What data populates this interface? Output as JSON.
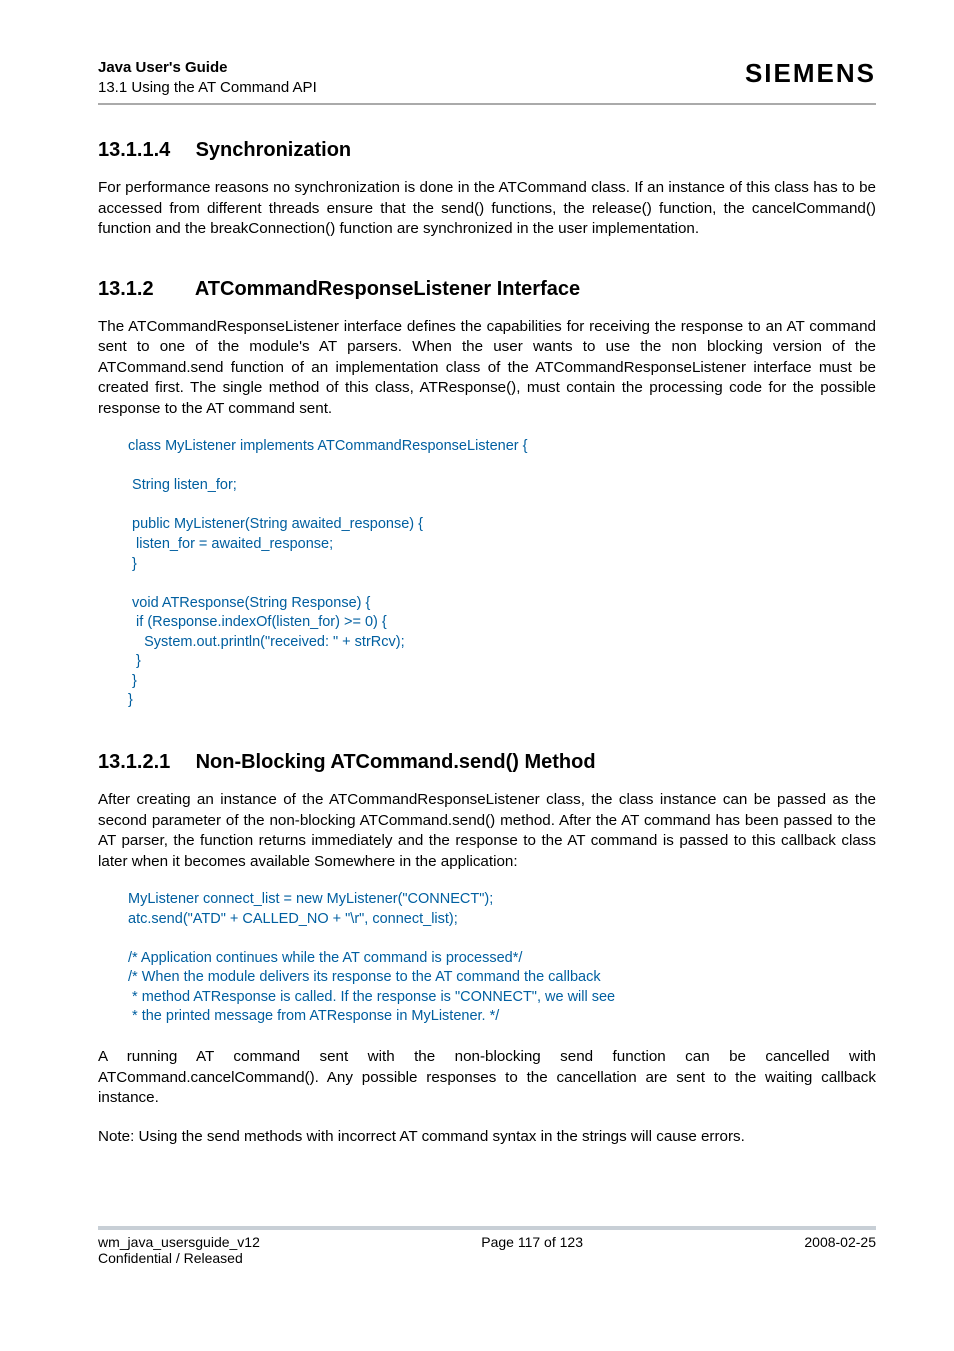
{
  "header": {
    "title": "Java User's Guide",
    "subtitle": "13.1 Using the AT Command API",
    "brand": "SIEMENS"
  },
  "sections": {
    "s1": {
      "num": "13.1.1.4",
      "title": "Synchronization",
      "para": "For performance reasons no synchronization is done in the ATCommand class. If an instance of this class has to be accessed from different threads ensure that the send() functions, the release() function, the cancelCommand() function and the breakConnection() function are synchronized in the user implementation."
    },
    "s2": {
      "num": "13.1.2",
      "title": "ATCommandResponseListener Interface",
      "para": "The ATCommandResponseListener interface defines the capabilities for receiving the response to an AT command sent to one of the module's AT parsers. When the user wants to use the non blocking version of the ATCommand.send function of an implementation class of the ATCommandResponseListener interface must be created first. The single method of this class, ATResponse(), must contain the processing code for the possible response to the AT command sent.",
      "code": "class MyListener implements ATCommandResponseListener {\n\n String listen_for;\n\n public MyListener(String awaited_response) {\n  listen_for = awaited_response;\n }\n\n void ATResponse(String Response) {\n  if (Response.indexOf(listen_for) >= 0) {\n    System.out.println(\"received: \" + strRcv);\n  }\n }\n}"
    },
    "s3": {
      "num": "13.1.2.1",
      "title": "Non-Blocking ATCommand.send() Method",
      "para1": "After creating an instance of the ATCommandResponseListener class, the class instance can be passed as the second parameter of the non-blocking ATCommand.send() method. After the AT command has been passed to the AT parser, the function returns immediately and the response to the AT command is passed to this callback class later when it becomes available Somewhere in the application:",
      "code": "MyListener connect_list = new MyListener(\"CONNECT\");\natc.send(\"ATD\" + CALLED_NO + \"\\r\", connect_list);\n\n/* Application continues while the AT command is processed*/\n/* When the module delivers its response to the AT command the callback\n * method ATResponse is called. If the response is \"CONNECT\", we will see\n * the printed message from ATResponse in MyListener. */",
      "para2": "A running AT command sent with the non-blocking send function can be cancelled with ATCommand.cancelCommand(). Any possible responses to the cancellation are sent to the waiting callback instance.",
      "para3": "Note: Using the send methods with incorrect AT command syntax in the strings will cause errors."
    }
  },
  "footer": {
    "left1": "wm_java_usersguide_v12",
    "left2": "Confidential / Released",
    "center": "Page 117 of 123",
    "right": "2008-02-25"
  }
}
